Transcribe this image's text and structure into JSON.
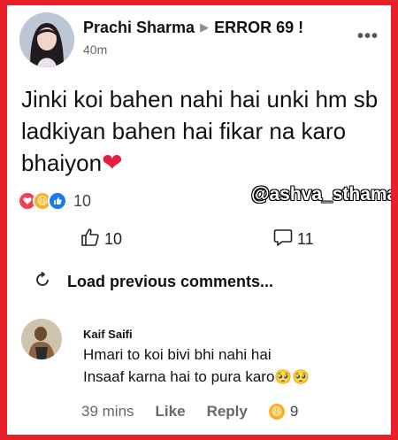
{
  "post": {
    "author": "Prachi Sharma",
    "arrow": "▶",
    "group": "ERROR 69 !",
    "time": "40m",
    "more": "•••",
    "text": "Jinki koi bahen nahi hai unki hm sb ladkiyan bahen hai fikar na karo bhaiyon",
    "heart": "❤",
    "reaction_count": "10",
    "watermark": "@ashva_sthama",
    "likes": "10",
    "comments": "11"
  },
  "load_previous": "Load previous comments...",
  "comment": {
    "author": "Kaif Saifi",
    "line1": "Hmari to koi bivi bhi nahi hai",
    "line2": "Insaaf karna hai to pura karo",
    "emoji": "🥺🥺",
    "time": "39 mins",
    "like_label": "Like",
    "reply_label": "Reply",
    "reaction_count": "9"
  },
  "colors": {
    "frame": "#e8202a",
    "love": "#f33e58",
    "haha": "#f7b125",
    "like": "#1877f2"
  },
  "icons": [
    "thumbs-up-icon",
    "comment-icon",
    "refresh-icon",
    "love-reaction-icon",
    "haha-reaction-icon",
    "like-reaction-icon"
  ]
}
